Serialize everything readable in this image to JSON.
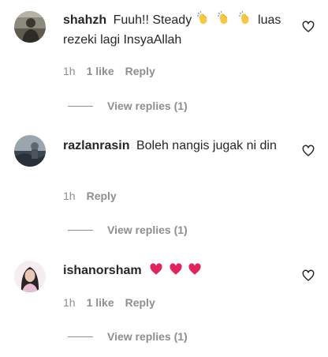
{
  "comments": [
    {
      "username": "shahzh",
      "text_before": "Fuuh!! Steady",
      "text_after": "luas rezeki lagi InsyaAllah",
      "emoji": [
        "clapping-hands",
        "clapping-hands",
        "clapping-hands"
      ],
      "time": "1h",
      "likes": "1 like",
      "reply": "Reply",
      "view_replies": "View replies (1)"
    },
    {
      "username": "razlanrasin",
      "text": "Boleh nangis jugak ni din",
      "time": "1h",
      "reply": "Reply",
      "view_replies": "View replies (1)"
    },
    {
      "username": "ishanorsham",
      "emoji": [
        "red-heart",
        "red-heart",
        "red-heart"
      ],
      "time": "1h",
      "likes": "1 like",
      "reply": "Reply",
      "view_replies": "View replies (1)"
    }
  ],
  "colors": {
    "text": "#262626",
    "secondary": "#8e8e8e",
    "heart_emoji": "#e0245e",
    "clap_emoji": "#f7c843"
  },
  "icons": {
    "like": "heart-outline-icon"
  }
}
